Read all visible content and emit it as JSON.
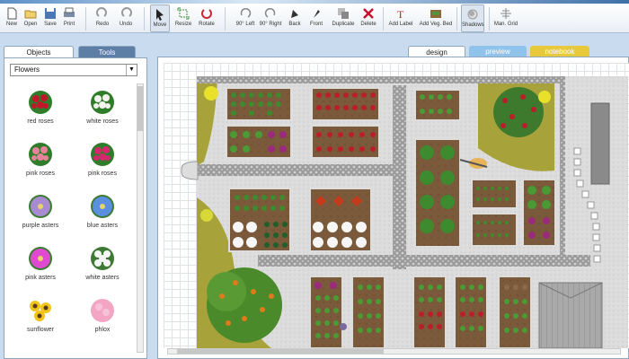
{
  "toolbar": {
    "buttons": [
      {
        "label": "New",
        "icon": "new-file-icon"
      },
      {
        "label": "Open",
        "icon": "open-folder-icon"
      },
      {
        "label": "Save",
        "icon": "save-disk-icon"
      },
      {
        "label": "Print",
        "icon": "print-icon"
      },
      {
        "label": "Redo",
        "icon": "redo-icon"
      },
      {
        "label": "Undo",
        "icon": "undo-icon"
      },
      {
        "label": "Move",
        "icon": "pointer-icon"
      },
      {
        "label": "Resize",
        "icon": "resize-icon"
      },
      {
        "label": "Rotate",
        "icon": "rotate-icon"
      },
      {
        "label": "90° Left",
        "icon": "rotate-left-icon"
      },
      {
        "label": "90° Right",
        "icon": "rotate-right-icon"
      },
      {
        "label": "Back",
        "icon": "send-back-icon"
      },
      {
        "label": "Front",
        "icon": "bring-front-icon"
      },
      {
        "label": "Duplicate",
        "icon": "duplicate-icon"
      },
      {
        "label": "Delete",
        "icon": "delete-icon"
      },
      {
        "label": "Add Label",
        "icon": "text-label-icon"
      },
      {
        "label": "Add Veg. Bed",
        "icon": "veg-bed-icon"
      },
      {
        "label": "Shadows",
        "icon": "shadows-icon"
      },
      {
        "label": "Man. Grid",
        "icon": "grid-icon"
      }
    ]
  },
  "panel": {
    "tabs": [
      "Objects",
      "Tools"
    ],
    "category": "Flowers",
    "plants": [
      {
        "name": "red roses",
        "color": "#c0182a"
      },
      {
        "name": "white roses",
        "color": "#f4f4ee"
      },
      {
        "name": "pink roses",
        "color": "#e8829a"
      },
      {
        "name": "pink roses",
        "color": "#d8266e"
      },
      {
        "name": "purple asters",
        "color": "#a88ad0"
      },
      {
        "name": "blue asters",
        "color": "#5b8fe0"
      },
      {
        "name": "pink asters",
        "color": "#e04ad0"
      },
      {
        "name": "white asters",
        "color": "#f6f6f6"
      },
      {
        "name": "sunflower",
        "color": "#f0c419"
      },
      {
        "name": "phlox",
        "color": "#f3a6c4"
      }
    ]
  },
  "view_tabs": [
    {
      "label": "design",
      "bg": "#ffffff",
      "fg": "#222222"
    },
    {
      "label": "preview",
      "bg": "#8fc3ec",
      "fg": "#ffffff"
    },
    {
      "label": "notebook",
      "bg": "#e8c93c",
      "fg": "#ffffff"
    }
  ]
}
